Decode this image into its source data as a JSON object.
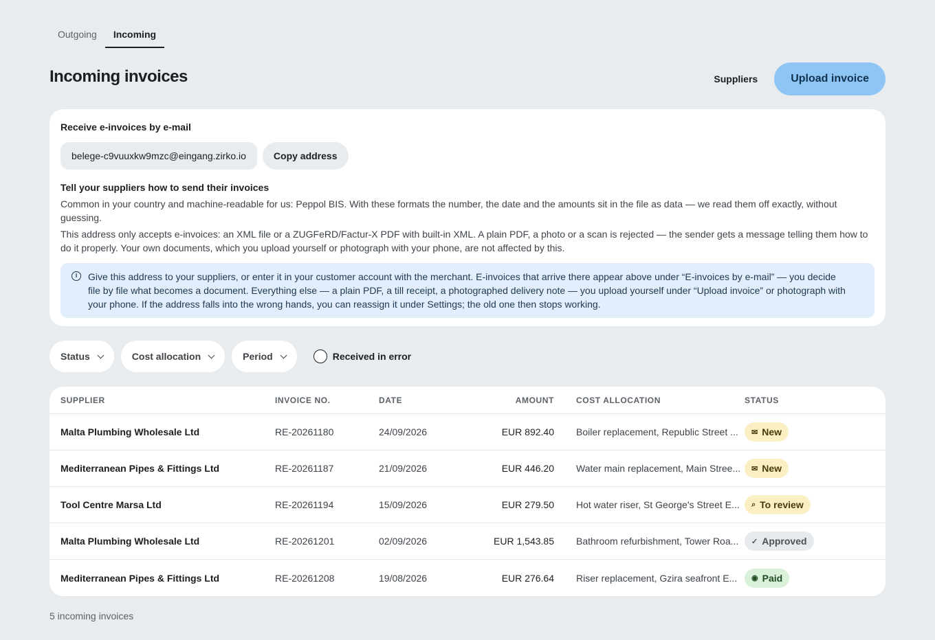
{
  "tabs": [
    {
      "label": "Outgoing",
      "active": false
    },
    {
      "label": "Incoming",
      "active": true
    }
  ],
  "page_title": "Incoming invoices",
  "header": {
    "suppliers_label": "Suppliers",
    "upload_label": "Upload invoice"
  },
  "email_card": {
    "heading": "Receive e-invoices by e-mail",
    "address": "belege-c9vuuxkw9mzc@eingang.zirko.io",
    "copy_label": "Copy address",
    "subheading": "Tell your suppliers how to send their invoices",
    "para1": "Common in your country and machine-readable for us: Peppol BIS. With these formats the number, the date and the amounts sit in the file as data — we read them off exactly, without guessing.",
    "para2": "This address only accepts e-invoices: an XML file or a ZUGFeRD/Factur-X PDF with built-in XML. A plain PDF, a photo or a scan is rejected — the sender gets a message telling them how to do it properly. Your own documents, which you upload yourself or photograph with your phone, are not affected by this.",
    "info": "Give this address to your suppliers, or enter it in your customer account with the merchant. E-invoices that arrive there appear above under “E-invoices by e-mail” — you decide file by file what becomes a document. Everything else — a plain PDF, a till receipt, a photographed delivery note — you upload yourself under “Upload invoice” or photograph with your phone. If the address falls into the wrong hands, you can reassign it under Settings; the old one then stops working.",
    "info_icon": "info-icon"
  },
  "filters": {
    "status": "Status",
    "cost_allocation": "Cost allocation",
    "period": "Period",
    "received_in_error": "Received in error",
    "received_in_error_checked": false
  },
  "table": {
    "headers": {
      "supplier": "SUPPLIER",
      "invoice_no": "INVOICE NO.",
      "date": "DATE",
      "amount": "AMOUNT",
      "cost_allocation": "COST ALLOCATION",
      "status": "STATUS"
    },
    "rows": [
      {
        "supplier": "Malta Plumbing Wholesale Ltd",
        "invoice_no": "RE-20261180",
        "date": "24/09/2026",
        "amount": "EUR 892.40",
        "cost_allocation": "Boiler replacement, Republic Street ...",
        "status": "New",
        "status_icon": "mail-icon",
        "status_bg": "#fbefc4",
        "status_fg": "#4a3a0a"
      },
      {
        "supplier": "Mediterranean Pipes & Fittings Ltd",
        "invoice_no": "RE-20261187",
        "date": "21/09/2026",
        "amount": "EUR 446.20",
        "cost_allocation": "Water main replacement, Main Stree...",
        "status": "New",
        "status_icon": "mail-icon",
        "status_bg": "#fbefc4",
        "status_fg": "#4a3a0a"
      },
      {
        "supplier": "Tool Centre Marsa Ltd",
        "invoice_no": "RE-20261194",
        "date": "15/09/2026",
        "amount": "EUR 279.50",
        "cost_allocation": "Hot water riser, St George's Street E...",
        "status": "To review",
        "status_icon": "search-icon",
        "status_bg": "#fbefc4",
        "status_fg": "#4a3a0a"
      },
      {
        "supplier": "Malta Plumbing Wholesale Ltd",
        "invoice_no": "RE-20261201",
        "date": "02/09/2026",
        "amount": "EUR 1,543.85",
        "cost_allocation": "Bathroom refurbishment, Tower Roa...",
        "status": "Approved",
        "status_icon": "check-icon",
        "status_bg": "#e7eaed",
        "status_fg": "#4b5158"
      },
      {
        "supplier": "Mediterranean Pipes & Fittings Ltd",
        "invoice_no": "RE-20261208",
        "date": "19/08/2026",
        "amount": "EUR 276.64",
        "cost_allocation": "Riser replacement, Gzira seafront E...",
        "status": "Paid",
        "status_icon": "check-circle-icon",
        "status_bg": "#d9f0d9",
        "status_fg": "#1f4d22"
      }
    ]
  },
  "footer_count": "5 incoming invoices"
}
